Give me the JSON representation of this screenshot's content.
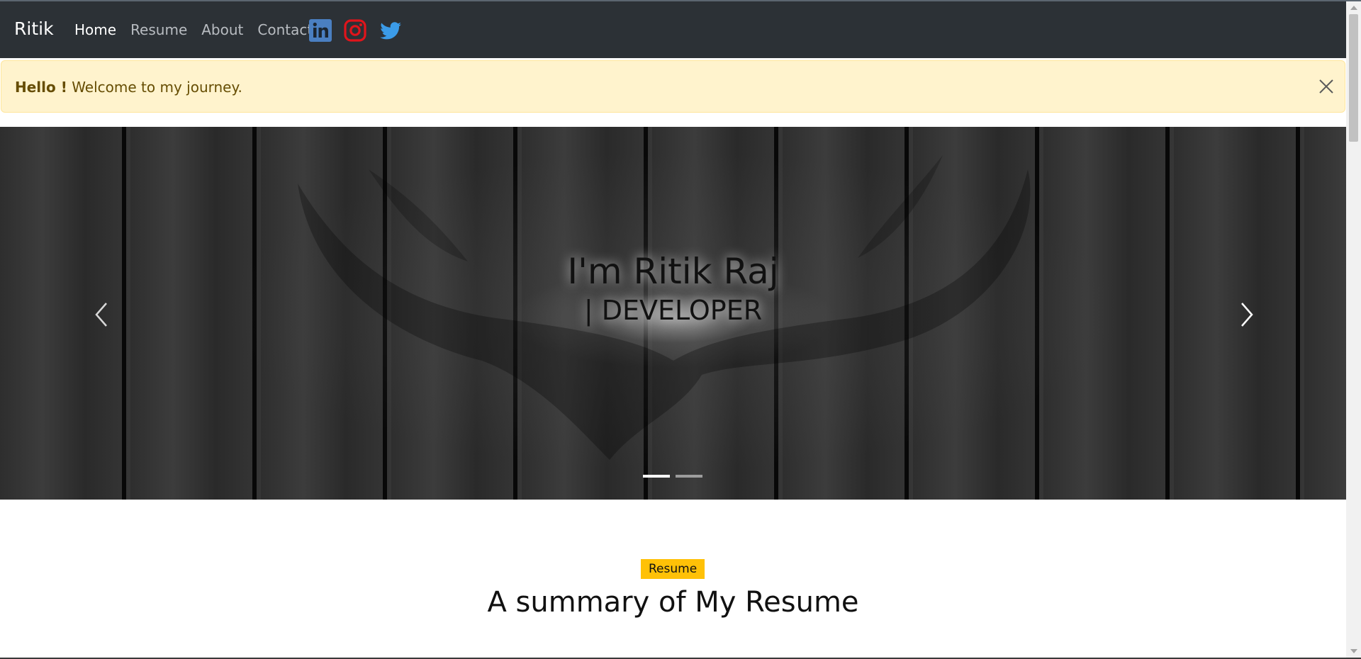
{
  "navbar": {
    "brand": "Ritik",
    "links": [
      "Home",
      "Resume",
      "About",
      "Contact"
    ],
    "active": "Home",
    "social_icons": [
      "linkedin-icon",
      "instagram-icon",
      "twitter-icon"
    ]
  },
  "alert": {
    "strong": "Hello !",
    "text": " Welcome to my journey.",
    "close_icon": "close-icon"
  },
  "carousel": {
    "title": "I'm Ritik Raj",
    "subtitle": "| DEVELOPER",
    "prev_icon": "chevron-left-icon",
    "next_icon": "chevron-right-icon",
    "slide_count": 2,
    "active_slide": 1
  },
  "resume_section": {
    "badge": "Resume",
    "title": "A summary of My Resume"
  },
  "colors": {
    "navbar_bg": "#2c3136",
    "alert_bg": "#fff3cd",
    "badge_bg": "#ffc107",
    "linkedin": "#4a7fc1",
    "instagram": "#e1141b",
    "twitter": "#3b9be8"
  }
}
